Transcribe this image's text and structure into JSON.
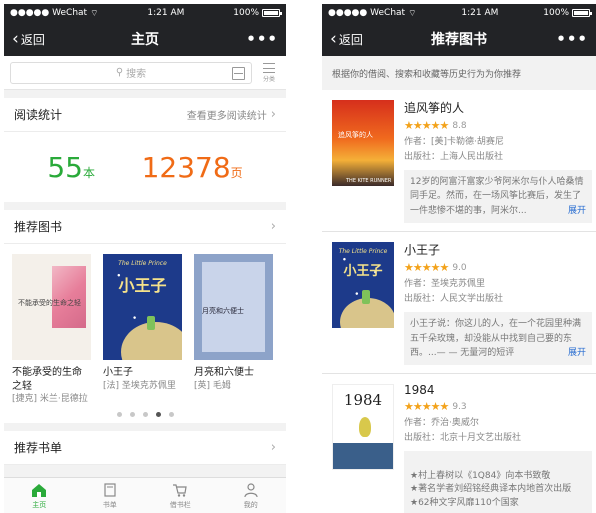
{
  "left": {
    "status": {
      "carrier": "●●●●● WeChat",
      "wifi": "⌔",
      "time": "1:21 AM",
      "battery": "100%"
    },
    "nav": {
      "back": "返回",
      "title": "主页",
      "more": "•••"
    },
    "search": {
      "placeholder": "搜索",
      "category": "分类"
    },
    "stats": {
      "title": "阅读统计",
      "more": "查看更多阅读统计",
      "books_count": "55",
      "books_unit": "本",
      "pages_count": "12378",
      "pages_unit": "页"
    },
    "recommend": {
      "title": "推荐图书",
      "books": [
        {
          "title": "不能承受的生命之轻",
          "author": "[捷克] 米兰·昆德拉",
          "cover_text": "不能承受的生命之轻"
        },
        {
          "title": "小王子",
          "author": "[法] 圣埃克苏佩里",
          "cover_text": "小王子",
          "cover_caption": "The Little Prince"
        },
        {
          "title": "月亮和六便士",
          "author": "[英] 毛姆",
          "cover_text": "月亮和六便士"
        }
      ],
      "dots": 5,
      "active_dot": 3
    },
    "booklist": {
      "title": "推荐书单"
    },
    "tabs": [
      {
        "label": "主页",
        "icon": "home-icon",
        "active": true
      },
      {
        "label": "书单",
        "icon": "book-icon",
        "active": false
      },
      {
        "label": "借书栏",
        "icon": "cart-icon",
        "active": false
      },
      {
        "label": "我的",
        "icon": "user-icon",
        "active": false
      }
    ],
    "accent_green": "#2aaa3a",
    "accent_orange": "#f06b16"
  },
  "right": {
    "status": {
      "carrier": "●●●●● WeChat",
      "wifi": "⌔",
      "time": "1:21 AM",
      "battery": "100%"
    },
    "nav": {
      "back": "返回",
      "title": "推荐图书",
      "more": "•••"
    },
    "hint": "根据你的借阅、搜索和收藏等历史行为为你推荐",
    "books": [
      {
        "title": "追风筝的人",
        "stars": "★★★★★",
        "score": "8.8",
        "author": "作者：[美]卡勒德·胡赛尼",
        "publisher": "出版社：上海人民出版社",
        "desc": "12岁的阿富汗富家少爷阿米尔与仆人哈桑情同手足。然而，在一场风筝比赛后，发生了一件悲惨不堪的事，阿米尔...",
        "expand": "展开",
        "cover_text": "追风筝的人",
        "cover_sub": "THE KITE RUNNER"
      },
      {
        "title": "小王子",
        "stars": "★★★★★",
        "score": "9.0",
        "author": "作者：圣埃克苏佩里",
        "publisher": "出版社：人民文学出版社",
        "desc": "小王子说：你这儿的人，在一个花园里种满五千朵玫瑰，却没能从中找到自己要的东西。...— — 无量河的短评",
        "expand": "展开",
        "cover_text": "小王子",
        "cover_caption": "The Little Prince"
      },
      {
        "title": "1984",
        "stars": "★★★★★",
        "score": "9.3",
        "author": "作者：乔治·奥威尔",
        "publisher": "出版社：北京十月文艺出版社",
        "desc": "★村上春树以《1Q84》向本书致敬\n★著名学者刘绍铭经典译本内地首次出版\n★62种文字风靡110个国家",
        "cover_text": "1984"
      }
    ]
  }
}
